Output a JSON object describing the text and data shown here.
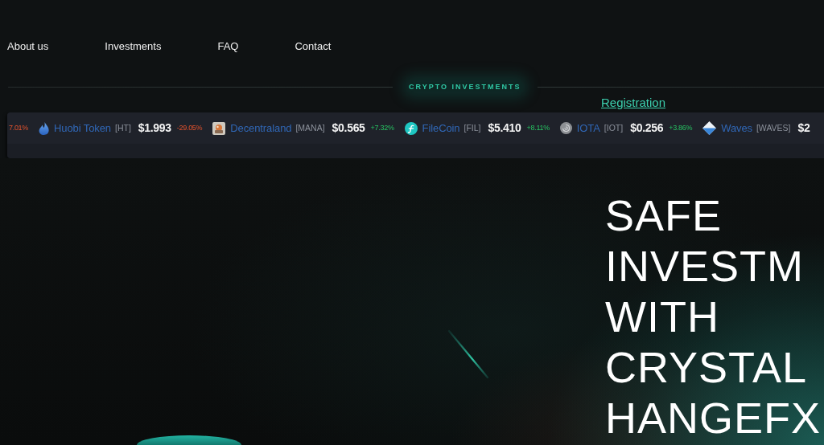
{
  "nav": {
    "links": [
      "About us",
      "Investments",
      "FAQ",
      "Contact"
    ]
  },
  "divider": {
    "label": "CRYPTO INVESTMENTS"
  },
  "registration_link": "Registration",
  "ticker": {
    "items": [
      {
        "change": "7.01%",
        "rising": false
      },
      {
        "kind": "flame",
        "name": "Huobi Token",
        "symbol": "[HT]",
        "price": "$1.993",
        "change": "-29.05%",
        "rising": false
      },
      {
        "kind": "thumbnail",
        "name": "Decentraland",
        "symbol": "[MANA]",
        "price": "$0.565",
        "change": "+7.32%",
        "rising": true
      },
      {
        "kind": "coin",
        "name": "FileCoin",
        "symbol": "[FIL]",
        "price": "$5.410",
        "change": "+8.11%",
        "rising": true
      },
      {
        "kind": "swirl",
        "name": "IOTA",
        "symbol": "[IOT]",
        "price": "$0.256",
        "change": "+3.86%",
        "rising": true
      },
      {
        "kind": "diamond",
        "name": "Waves",
        "symbol": "[WAVES]",
        "price": "$2"
      }
    ]
  },
  "hero": {
    "title_lines": [
      "SAFE",
      "INVESTM",
      "WITH",
      "CRYSTAL",
      "HANGEFX"
    ]
  }
}
